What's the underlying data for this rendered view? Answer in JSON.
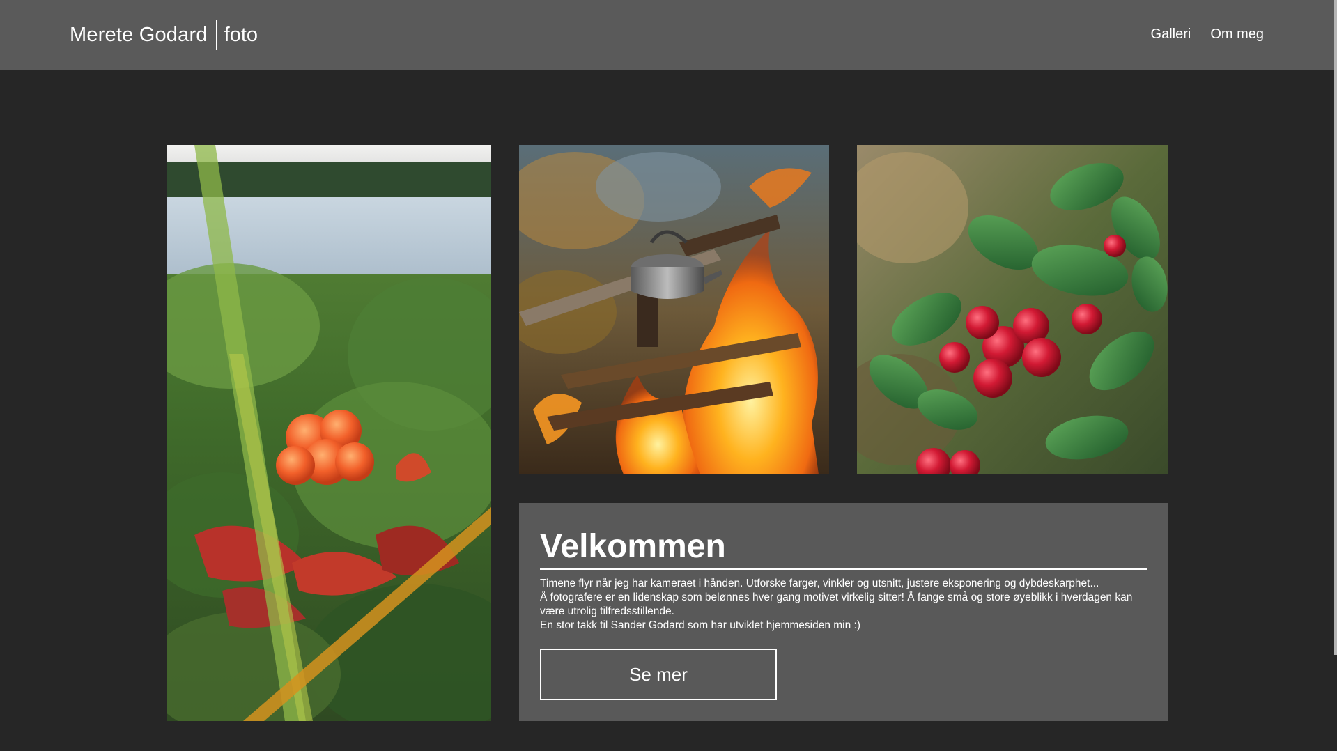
{
  "header": {
    "brand_name": "Merete Godard",
    "brand_sub": "foto",
    "nav": [
      {
        "label": "Galleri"
      },
      {
        "label": "Om meg"
      }
    ]
  },
  "photos": [
    {
      "subject": "cloudberry"
    },
    {
      "subject": "campfire-kettle"
    },
    {
      "subject": "lingonberries"
    }
  ],
  "welcome": {
    "title": "Velkommen",
    "paragraphs": [
      "Timene flyr når jeg har kameraet i hånden. Utforske farger, vinkler og utsnitt, justere eksponering og dybdeskarphet...",
      "Å fotografere er en lidenskap som belønnes hver gang motivet virkelig sitter! Å fange små og store øyeblikk i hverdagen kan være utrolig tilfredsstillende.",
      "En stor takk til Sander Godard som har utviklet hjemmesiden min :)"
    ],
    "button_label": "Se mer"
  },
  "colors": {
    "header_bg": "#5a5a5a",
    "page_bg": "#262626",
    "panel_bg": "#595959",
    "text": "#ffffff"
  }
}
